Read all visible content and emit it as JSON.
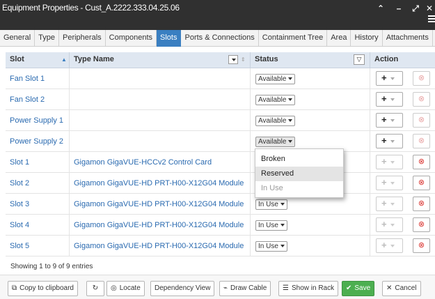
{
  "window": {
    "title": "Equipment Properties - Cust_A.2222.333.04.25.06",
    "controls": [
      "chevron-up-icon",
      "minimize-icon",
      "expand-icon",
      "close-icon"
    ]
  },
  "tabs": [
    {
      "label": "General",
      "active": false
    },
    {
      "label": "Type",
      "active": false
    },
    {
      "label": "Peripherals",
      "active": false
    },
    {
      "label": "Components",
      "active": false
    },
    {
      "label": "Slots",
      "active": true
    },
    {
      "label": "Ports & Connections",
      "active": false
    },
    {
      "label": "Containment Tree",
      "active": false
    },
    {
      "label": "Area",
      "active": false
    },
    {
      "label": "History",
      "active": false
    },
    {
      "label": "Attachments",
      "active": false
    }
  ],
  "table": {
    "headers": {
      "slot": "Slot",
      "type_name": "Type Name",
      "status": "Status",
      "action": "Action"
    },
    "rows": [
      {
        "slot": "Fan Slot 1",
        "type_name": "",
        "status": "Available",
        "action_enabled": true
      },
      {
        "slot": "Fan Slot 2",
        "type_name": "",
        "status": "Available",
        "action_enabled": true
      },
      {
        "slot": "Power Supply 1",
        "type_name": "",
        "status": "Available",
        "action_enabled": true
      },
      {
        "slot": "Power Supply 2",
        "type_name": "",
        "status": "Available",
        "action_enabled": true
      },
      {
        "slot": "Slot 1",
        "type_name": "Gigamon GigaVUE-HCCv2 Control Card",
        "status": "",
        "action_enabled": false
      },
      {
        "slot": "Slot 2",
        "type_name": "Gigamon GigaVUE-HD PRT-H00-X12G04 Module",
        "status": "",
        "action_enabled": false
      },
      {
        "slot": "Slot 3",
        "type_name": "Gigamon GigaVUE-HD PRT-H00-X12G04 Module",
        "status": "In Use",
        "action_enabled": false
      },
      {
        "slot": "Slot 4",
        "type_name": "Gigamon GigaVUE-HD PRT-H00-X12G04 Module",
        "status": "In Use",
        "action_enabled": false
      },
      {
        "slot": "Slot 5",
        "type_name": "Gigamon GigaVUE-HD PRT-H00-X12G04 Module",
        "status": "In Use",
        "action_enabled": false
      }
    ]
  },
  "status_dropdown": {
    "options": [
      {
        "label": "Broken",
        "state": "normal"
      },
      {
        "label": "Reserved",
        "state": "hover"
      },
      {
        "label": "In Use",
        "state": "disabled"
      }
    ]
  },
  "info": "Showing 1 to 9 of 9 entries",
  "footer": {
    "copy": "Copy to clipboard",
    "locate": "Locate",
    "dependency": "Dependency View",
    "draw_cable": "Draw Cable",
    "show_in_rack": "Show in Rack",
    "save": "Save",
    "cancel": "Cancel"
  },
  "colors": {
    "active_tab": "#3a7fc1",
    "save": "#4caf50",
    "link": "#2a6ab0",
    "delete": "#d9302c"
  }
}
